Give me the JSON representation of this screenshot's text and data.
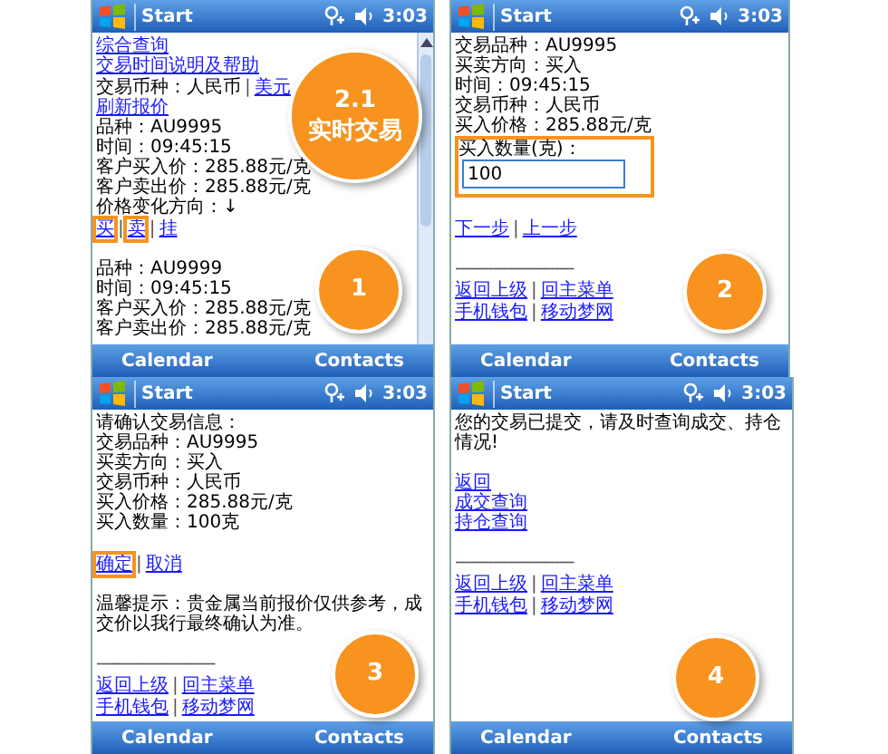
{
  "screens": [
    {
      "title": "Start",
      "time": "3:03",
      "scrollbar": true,
      "softkeys": [
        "Calendar",
        "Contacts"
      ],
      "badges": [
        {
          "kind": "large",
          "lines": [
            "2.1",
            "实时交易"
          ]
        },
        {
          "kind": "small",
          "lines": [
            "1"
          ]
        }
      ],
      "lines": [
        {
          "kind": "link",
          "text": "综合查询"
        },
        {
          "kind": "link",
          "text": "交易时间说明及帮助"
        },
        {
          "kind": "links",
          "prefix": "交易币种：人民币",
          "separator": "|",
          "links": [
            {
              "text": "美元",
              "highlighted": false
            }
          ]
        },
        {
          "kind": "link",
          "text": "刷新报价"
        },
        {
          "kind": "text",
          "text": "品种：AU9995"
        },
        {
          "kind": "text",
          "text": "时间：09:45:15"
        },
        {
          "kind": "text",
          "text": "客户买入价：285.88元/克"
        },
        {
          "kind": "text",
          "text": "客户卖出价：285.88元/克"
        },
        {
          "kind": "text",
          "text": "价格变化方向：↓"
        },
        {
          "kind": "links",
          "separator": "|",
          "links": [
            {
              "text": "买",
              "highlighted": true
            },
            {
              "text": "卖",
              "highlighted": true
            },
            {
              "text": "挂",
              "highlighted": false
            }
          ]
        },
        {
          "kind": "blank"
        },
        {
          "kind": "text",
          "text": "品种：AU9999"
        },
        {
          "kind": "text",
          "text": "时间：09:45:15"
        },
        {
          "kind": "text",
          "text": "客户买入价：285.88元/克"
        },
        {
          "kind": "text",
          "text": "客户卖出价：285.88元/克"
        }
      ]
    },
    {
      "title": "Start",
      "time": "3:03",
      "scrollbar": false,
      "softkeys": [
        "Calendar",
        "Contacts"
      ],
      "badges": [
        {
          "kind": "small",
          "lines": [
            "2"
          ]
        }
      ],
      "lines": [
        {
          "kind": "text",
          "text": "交易品种：AU9995"
        },
        {
          "kind": "text",
          "text": "买卖方向：买入"
        },
        {
          "kind": "text",
          "text": "时间：09:45:15"
        },
        {
          "kind": "text",
          "text": "交易币种：人民币"
        },
        {
          "kind": "text",
          "text": "买入价格：285.88元/克"
        },
        {
          "kind": "field",
          "label": "买入数量(克)：",
          "value": "100",
          "highlighted": true
        },
        {
          "kind": "blank"
        },
        {
          "kind": "links",
          "separator": "|",
          "links": [
            {
              "text": "下一步",
              "highlighted": false
            },
            {
              "text": "上一步",
              "highlighted": false
            }
          ]
        },
        {
          "kind": "blank"
        },
        {
          "kind": "rule",
          "text": "-------------------------"
        },
        {
          "kind": "links",
          "separator": "|",
          "links": [
            {
              "text": "返回上级",
              "highlighted": false
            },
            {
              "text": "回主菜单",
              "highlighted": false
            }
          ]
        },
        {
          "kind": "links",
          "separator": "|",
          "links": [
            {
              "text": "手机钱包",
              "highlighted": false
            },
            {
              "text": "移动梦网",
              "highlighted": false
            }
          ]
        }
      ]
    },
    {
      "title": "Start",
      "time": "3:03",
      "scrollbar": false,
      "softkeys": [
        "Calendar",
        "Contacts"
      ],
      "badges": [
        {
          "kind": "small",
          "lines": [
            "3"
          ]
        }
      ],
      "lines": [
        {
          "kind": "text",
          "text": "请确认交易信息："
        },
        {
          "kind": "text",
          "text": "交易品种：AU9995"
        },
        {
          "kind": "text",
          "text": "买卖方向：买入"
        },
        {
          "kind": "text",
          "text": "交易币种：人民币"
        },
        {
          "kind": "text",
          "text": "买入价格：285.88元/克"
        },
        {
          "kind": "text",
          "text": "买入数量：100克"
        },
        {
          "kind": "blank"
        },
        {
          "kind": "links",
          "separator": "|",
          "links": [
            {
              "text": "确定",
              "highlighted": true
            },
            {
              "text": "取消",
              "highlighted": false
            }
          ]
        },
        {
          "kind": "blank"
        },
        {
          "kind": "text",
          "text": "温馨提示：贵金属当前报价仅供参考，成交价以我行最终确认为准。"
        },
        {
          "kind": "blank"
        },
        {
          "kind": "rule",
          "text": "-------------------------"
        },
        {
          "kind": "links",
          "separator": "|",
          "links": [
            {
              "text": "返回上级",
              "highlighted": false
            },
            {
              "text": "回主菜单",
              "highlighted": false
            }
          ]
        },
        {
          "kind": "links",
          "separator": "|",
          "links": [
            {
              "text": "手机钱包",
              "highlighted": false
            },
            {
              "text": "移动梦网",
              "highlighted": false
            }
          ]
        }
      ]
    },
    {
      "title": "Start",
      "time": "3:03",
      "scrollbar": false,
      "softkeys": [
        "Calendar",
        "Contacts"
      ],
      "badges": [
        {
          "kind": "small",
          "lines": [
            "4"
          ]
        }
      ],
      "lines": [
        {
          "kind": "text",
          "text": "您的交易已提交，请及时查询成交、持仓情况!"
        },
        {
          "kind": "blank"
        },
        {
          "kind": "link",
          "text": "返回"
        },
        {
          "kind": "link",
          "text": "成交查询"
        },
        {
          "kind": "link",
          "text": "持仓查询"
        },
        {
          "kind": "blank"
        },
        {
          "kind": "rule",
          "text": "-------------------------"
        },
        {
          "kind": "links",
          "separator": "|",
          "links": [
            {
              "text": "返回上级",
              "highlighted": false
            },
            {
              "text": "回主菜单",
              "highlighted": false
            }
          ]
        },
        {
          "kind": "links",
          "separator": "|",
          "links": [
            {
              "text": "手机钱包",
              "highlighted": false
            },
            {
              "text": "移动梦网",
              "highlighted": false
            }
          ]
        }
      ]
    }
  ]
}
